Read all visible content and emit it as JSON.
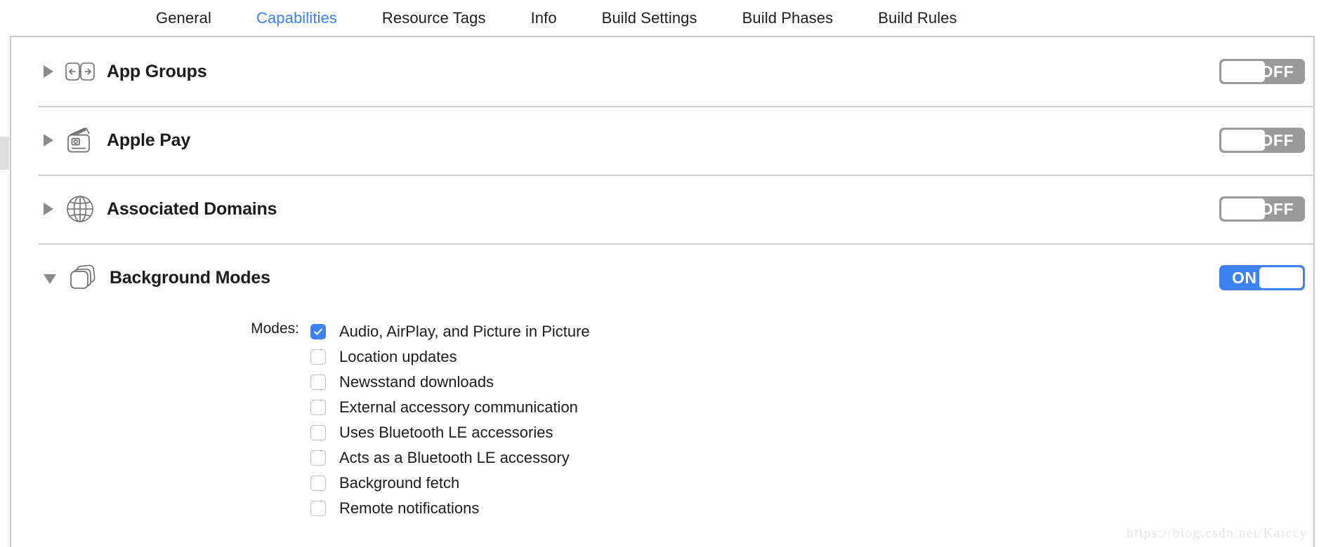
{
  "tabs": [
    {
      "label": "General",
      "active": false
    },
    {
      "label": "Capabilities",
      "active": true
    },
    {
      "label": "Resource Tags",
      "active": false
    },
    {
      "label": "Info",
      "active": false
    },
    {
      "label": "Build Settings",
      "active": false
    },
    {
      "label": "Build Phases",
      "active": false
    },
    {
      "label": "Build Rules",
      "active": false
    }
  ],
  "colors": {
    "accent": "#3d82f2",
    "toggle_off": "#9a9a9a",
    "separator": "#cfcfcf",
    "text": "#1c1c1e",
    "icon_stroke": "#6e6e6e"
  },
  "capabilities": [
    {
      "title": "App Groups",
      "icon": "app-groups-icon",
      "expanded": false,
      "toggle_state": "OFF"
    },
    {
      "title": "Apple Pay",
      "icon": "apple-pay-card-icon",
      "expanded": false,
      "toggle_state": "OFF"
    },
    {
      "title": "Associated Domains",
      "icon": "globe-icon",
      "expanded": false,
      "toggle_state": "OFF"
    },
    {
      "title": "Background Modes",
      "icon": "stacked-windows-icon",
      "expanded": true,
      "toggle_state": "ON"
    }
  ],
  "background_modes": {
    "section_label": "Modes:",
    "items": [
      {
        "label": "Audio, AirPlay, and Picture in Picture",
        "checked": true
      },
      {
        "label": "Location updates",
        "checked": false
      },
      {
        "label": "Newsstand downloads",
        "checked": false
      },
      {
        "label": "External accessory communication",
        "checked": false
      },
      {
        "label": "Uses Bluetooth LE accessories",
        "checked": false
      },
      {
        "label": "Acts as a Bluetooth LE accessory",
        "checked": false
      },
      {
        "label": "Background fetch",
        "checked": false
      },
      {
        "label": "Remote notifications",
        "checked": false
      }
    ]
  },
  "watermark": "https://blog.csdn.net/Kaiccy"
}
